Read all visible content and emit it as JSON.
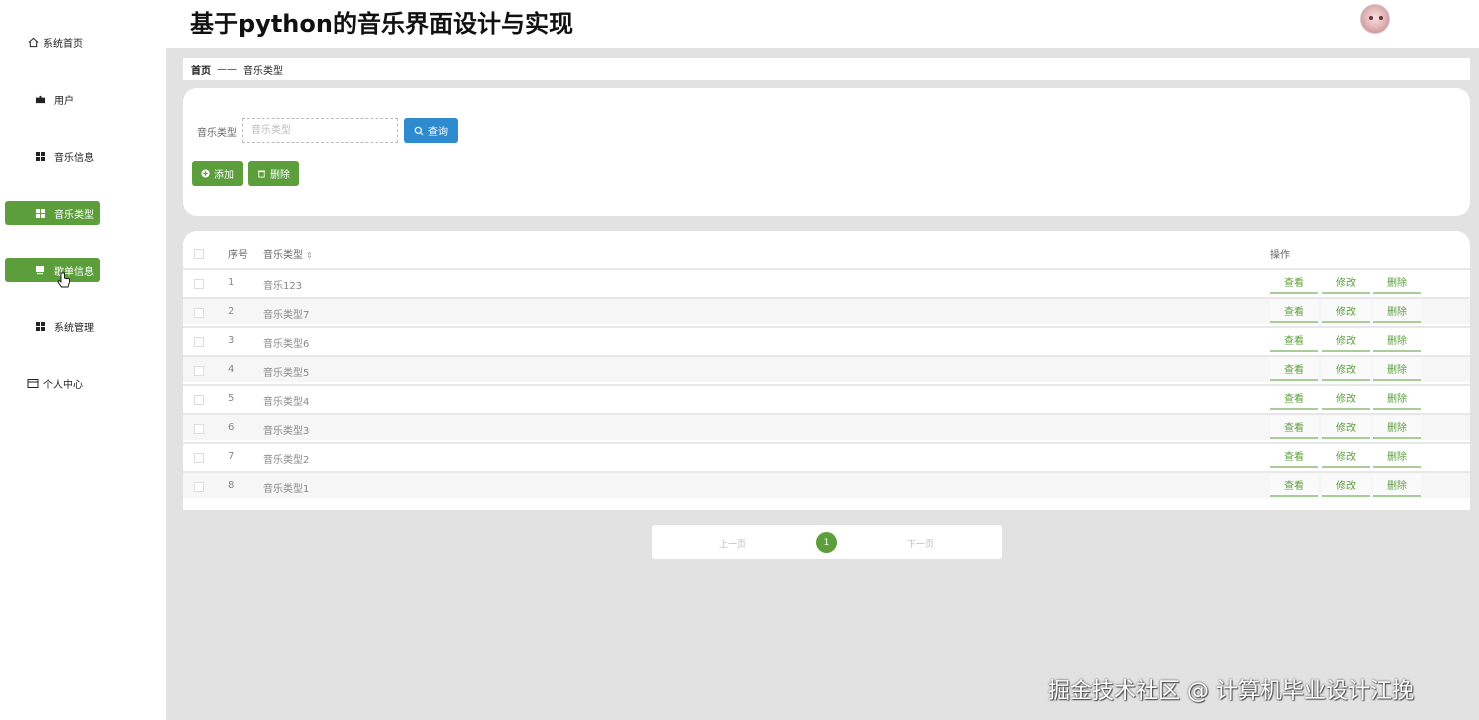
{
  "header": {
    "title": "基于python的音乐界面设计与实现"
  },
  "sidebar": {
    "items": [
      {
        "label": "系统首页",
        "icon": "home-icon",
        "active": false
      },
      {
        "label": "用户",
        "icon": "user-icon",
        "active": false
      },
      {
        "label": "音乐信息",
        "icon": "grid-icon",
        "active": false
      },
      {
        "label": "音乐类型",
        "icon": "grid-icon",
        "active": true
      },
      {
        "label": "歌单信息",
        "icon": "playlist-icon",
        "active": true
      },
      {
        "label": "系统管理",
        "icon": "grid-icon",
        "active": false
      },
      {
        "label": "个人中心",
        "icon": "profile-icon",
        "active": false
      }
    ]
  },
  "breadcrumb": {
    "home": "首页",
    "separator": "——",
    "current": "音乐类型"
  },
  "search": {
    "label": "音乐类型",
    "placeholder": "音乐类型",
    "value": "",
    "query_label": "查询"
  },
  "actions": {
    "add_label": "添加",
    "delete_label": "删除"
  },
  "table": {
    "headers": {
      "no": "序号",
      "type": "音乐类型",
      "op": "操作"
    },
    "op_labels": {
      "view": "查看",
      "edit": "修改",
      "delete": "删除"
    },
    "rows": [
      {
        "no": "1",
        "type": "音乐123"
      },
      {
        "no": "2",
        "type": "音乐类型7"
      },
      {
        "no": "3",
        "type": "音乐类型6"
      },
      {
        "no": "4",
        "type": "音乐类型5"
      },
      {
        "no": "5",
        "type": "音乐类型4"
      },
      {
        "no": "6",
        "type": "音乐类型3"
      },
      {
        "no": "7",
        "type": "音乐类型2"
      },
      {
        "no": "8",
        "type": "音乐类型1"
      }
    ]
  },
  "pagination": {
    "prev": "上一页",
    "current": "1",
    "next": "下一页"
  },
  "watermark": "掘金技术社区 @ 计算机毕业设计江挽",
  "colors": {
    "accent": "#5c9e3c",
    "query": "#2e8bd0",
    "background": "#e2e2e2"
  }
}
